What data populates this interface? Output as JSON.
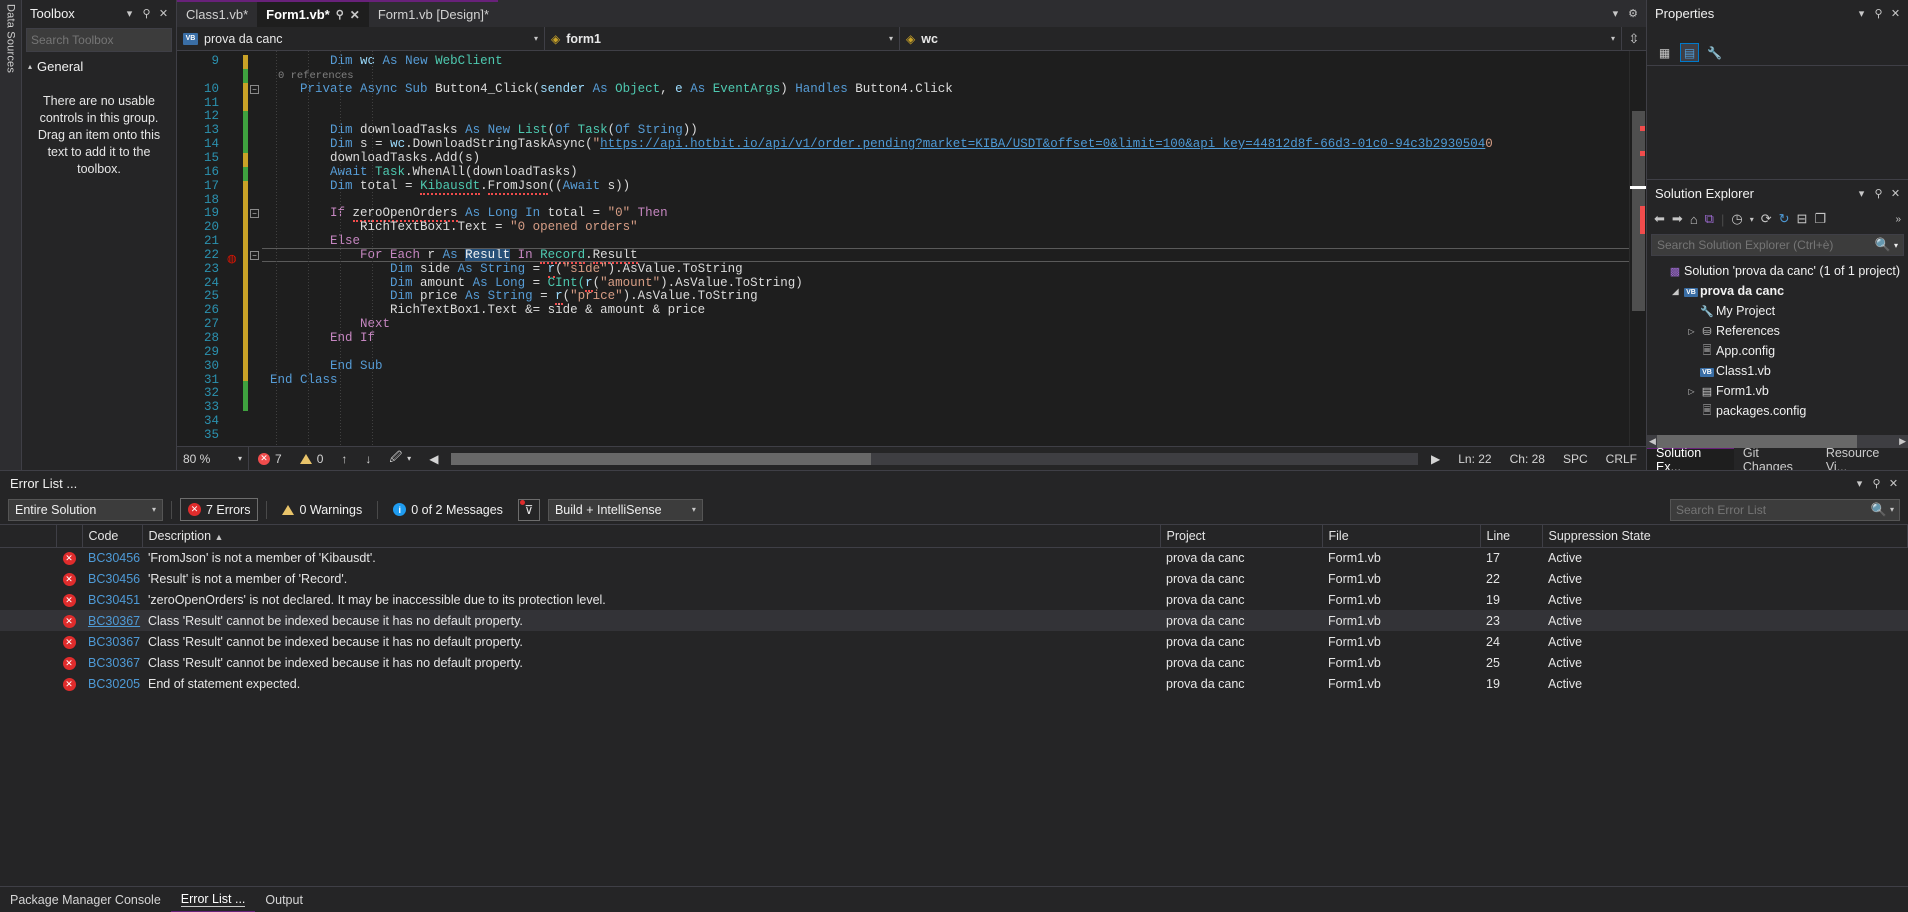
{
  "left_strip": {
    "label": "Data Sources"
  },
  "toolbox": {
    "title": "Toolbox",
    "search_placeholder": "Search Toolbox",
    "group_label": "General",
    "empty_message": "There are no usable controls in this group. Drag an item onto this text to add it to the toolbox.",
    "chevron": "▾",
    "pin": "⚲",
    "close": "✕",
    "magnifier": "🔍",
    "group_arrow": "▴"
  },
  "tabs": [
    {
      "label": "Class1.vb*",
      "active": false
    },
    {
      "label": "Form1.vb*",
      "active": true
    },
    {
      "label": "Form1.vb [Design]*",
      "active": false
    }
  ],
  "navbar": {
    "project": "prova da canc",
    "project_badge": "VB",
    "object": "form1",
    "member": "wc",
    "caret": "▾"
  },
  "editor": {
    "codelens": "0 references",
    "lines": [
      {
        "n": 9,
        "indent": 2,
        "tokens": [
          {
            "t": "Dim ",
            "c": "kw"
          },
          {
            "t": "wc",
            "c": "id"
          },
          {
            "t": " As ",
            "c": "kw"
          },
          {
            "t": "New ",
            "c": "kw"
          },
          {
            "t": "WebClient",
            "c": "ty"
          }
        ]
      },
      {
        "n": 10,
        "indent": 1,
        "fold": true,
        "tokens": [
          {
            "t": "Private ",
            "c": "kw"
          },
          {
            "t": "Async ",
            "c": "kw"
          },
          {
            "t": "Sub ",
            "c": "kw"
          },
          {
            "t": "Button4_Click",
            "c": "pl"
          },
          {
            "t": "(",
            "c": "pl"
          },
          {
            "t": "sender ",
            "c": "id"
          },
          {
            "t": "As ",
            "c": "kw"
          },
          {
            "t": "Object",
            "c": "ty"
          },
          {
            "t": ", ",
            "c": "pl"
          },
          {
            "t": "e ",
            "c": "id"
          },
          {
            "t": "As ",
            "c": "kw"
          },
          {
            "t": "EventArgs",
            "c": "ty"
          },
          {
            "t": ") ",
            "c": "pl"
          },
          {
            "t": "Handles ",
            "c": "kw"
          },
          {
            "t": "Button4.Click",
            "c": "pl"
          }
        ]
      },
      {
        "n": 11,
        "indent": 0,
        "tokens": []
      },
      {
        "n": 12,
        "indent": 0,
        "tokens": []
      },
      {
        "n": 13,
        "indent": 2,
        "tokens": [
          {
            "t": "Dim ",
            "c": "kw"
          },
          {
            "t": "downloadTasks",
            "c": "pl"
          },
          {
            "t": " As ",
            "c": "kw"
          },
          {
            "t": "New ",
            "c": "kw"
          },
          {
            "t": "List",
            "c": "ty"
          },
          {
            "t": "(",
            "c": "pl"
          },
          {
            "t": "Of ",
            "c": "kw"
          },
          {
            "t": "Task",
            "c": "ty"
          },
          {
            "t": "(",
            "c": "pl"
          },
          {
            "t": "Of ",
            "c": "kw"
          },
          {
            "t": "String",
            "c": "kw"
          },
          {
            "t": "))",
            "c": "pl"
          }
        ]
      },
      {
        "n": 14,
        "indent": 2,
        "tokens": [
          {
            "t": "Dim ",
            "c": "kw"
          },
          {
            "t": "s ",
            "c": "pl"
          },
          {
            "t": "= ",
            "c": "pl"
          },
          {
            "t": "wc",
            "c": "id"
          },
          {
            "t": ".DownloadStringTaskAsync",
            "c": "pl"
          },
          {
            "t": "(",
            "c": "pl"
          },
          {
            "t": "\"",
            "c": "st"
          },
          {
            "t": "https://api.hotbit.io/api/v1/order.pending?market=KIBA/USDT&offset=0&limit=100&api_key=44812d8f-66d3-01c0-94c3b2930504",
            "c": "link"
          },
          {
            "t": "0",
            "c": "st"
          }
        ]
      },
      {
        "n": 15,
        "indent": 2,
        "tokens": [
          {
            "t": "downloadTasks",
            "c": "pl"
          },
          {
            "t": ".Add(",
            "c": "pl"
          },
          {
            "t": "s",
            "c": "pl"
          },
          {
            "t": ")",
            "c": "pl"
          }
        ]
      },
      {
        "n": 16,
        "indent": 2,
        "tokens": [
          {
            "t": "Await ",
            "c": "kw"
          },
          {
            "t": "Task",
            "c": "ty"
          },
          {
            "t": ".WhenAll(",
            "c": "pl"
          },
          {
            "t": "downloadTasks",
            "c": "pl"
          },
          {
            "t": ")",
            "c": "pl"
          }
        ]
      },
      {
        "n": 17,
        "indent": 2,
        "tokens": [
          {
            "t": "Dim ",
            "c": "kw"
          },
          {
            "t": "total ",
            "c": "pl"
          },
          {
            "t": "= ",
            "c": "pl"
          },
          {
            "t": "Kibausdt",
            "c": "ty",
            "err": true
          },
          {
            "t": ".",
            "c": "pl"
          },
          {
            "t": "FromJson",
            "c": "pl",
            "err": true
          },
          {
            "t": "((",
            "c": "pl"
          },
          {
            "t": "Await ",
            "c": "kw"
          },
          {
            "t": "s",
            "c": "pl"
          },
          {
            "t": "))",
            "c": "pl"
          }
        ]
      },
      {
        "n": 18,
        "indent": 0,
        "tokens": []
      },
      {
        "n": 19,
        "indent": 2,
        "fold": true,
        "tokens": [
          {
            "t": "If ",
            "c": "kw2"
          },
          {
            "t": "zeroOpenOrders",
            "c": "pl",
            "err": true
          },
          {
            "t": " As ",
            "c": "kw"
          },
          {
            "t": "Long ",
            "c": "kw"
          },
          {
            "t": "In ",
            "c": "kw"
          },
          {
            "t": "total ",
            "c": "pl"
          },
          {
            "t": "= ",
            "c": "pl"
          },
          {
            "t": "\"0\" ",
            "c": "st"
          },
          {
            "t": "Then",
            "c": "kw2"
          }
        ]
      },
      {
        "n": 20,
        "indent": 3,
        "tokens": [
          {
            "t": "RichTextBox1",
            "c": "pl"
          },
          {
            "t": ".Text ",
            "c": "pl"
          },
          {
            "t": "= ",
            "c": "pl"
          },
          {
            "t": "\"0 opened orders\"",
            "c": "st"
          }
        ]
      },
      {
        "n": 21,
        "indent": 2,
        "tokens": [
          {
            "t": "Else",
            "c": "kw2"
          }
        ]
      },
      {
        "n": 22,
        "indent": 3,
        "fold": true,
        "current": true,
        "breakpoint": true,
        "tokens": [
          {
            "t": "For ",
            "c": "kw2"
          },
          {
            "t": "Each ",
            "c": "kw2"
          },
          {
            "t": "r ",
            "c": "pl"
          },
          {
            "t": "As ",
            "c": "kw"
          },
          {
            "t": "Result",
            "c": "sel"
          },
          {
            "t": " In ",
            "c": "kw2"
          },
          {
            "t": "Record",
            "c": "ty",
            "err": true
          },
          {
            "t": ".",
            "c": "pl"
          },
          {
            "t": "Result",
            "c": "pl",
            "err": true
          }
        ]
      },
      {
        "n": 23,
        "indent": 4,
        "tokens": [
          {
            "t": "Dim ",
            "c": "kw"
          },
          {
            "t": "side ",
            "c": "pl"
          },
          {
            "t": "As ",
            "c": "kw"
          },
          {
            "t": "String ",
            "c": "kw"
          },
          {
            "t": "= ",
            "c": "pl"
          },
          {
            "t": "r",
            "c": "id",
            "err": true
          },
          {
            "t": "(",
            "c": "pl"
          },
          {
            "t": "\"side\"",
            "c": "st"
          },
          {
            "t": ").AsValue.ToString",
            "c": "pl"
          }
        ]
      },
      {
        "n": 24,
        "indent": 4,
        "tokens": [
          {
            "t": "Dim ",
            "c": "kw"
          },
          {
            "t": "amount ",
            "c": "pl"
          },
          {
            "t": "As ",
            "c": "kw"
          },
          {
            "t": "Long ",
            "c": "kw"
          },
          {
            "t": "= ",
            "c": "pl"
          },
          {
            "t": "CInt(",
            "c": "ty"
          },
          {
            "t": "r",
            "c": "id",
            "err": true
          },
          {
            "t": "(",
            "c": "pl"
          },
          {
            "t": "\"amount\"",
            "c": "st"
          },
          {
            "t": ").AsValue.ToString)",
            "c": "pl"
          }
        ]
      },
      {
        "n": 25,
        "indent": 4,
        "tokens": [
          {
            "t": "Dim ",
            "c": "kw"
          },
          {
            "t": "price ",
            "c": "pl"
          },
          {
            "t": "As ",
            "c": "kw"
          },
          {
            "t": "String ",
            "c": "kw"
          },
          {
            "t": "= ",
            "c": "pl"
          },
          {
            "t": "r",
            "c": "id",
            "err": true
          },
          {
            "t": "(",
            "c": "pl"
          },
          {
            "t": "\"price\"",
            "c": "st"
          },
          {
            "t": ").AsValue.ToString",
            "c": "pl"
          }
        ]
      },
      {
        "n": 26,
        "indent": 4,
        "tokens": [
          {
            "t": "RichTextBox1",
            "c": "pl"
          },
          {
            "t": ".Text ",
            "c": "pl"
          },
          {
            "t": "&= ",
            "c": "pl"
          },
          {
            "t": "side ",
            "c": "pl"
          },
          {
            "t": "& ",
            "c": "pl"
          },
          {
            "t": "amount ",
            "c": "pl"
          },
          {
            "t": "& ",
            "c": "pl"
          },
          {
            "t": "price",
            "c": "pl"
          }
        ]
      },
      {
        "n": 27,
        "indent": 3,
        "tokens": [
          {
            "t": "Next",
            "c": "kw2"
          }
        ]
      },
      {
        "n": 28,
        "indent": 2,
        "tokens": [
          {
            "t": "End ",
            "c": "kw2"
          },
          {
            "t": "If",
            "c": "kw2"
          }
        ]
      },
      {
        "n": 29,
        "indent": 0,
        "tokens": []
      },
      {
        "n": 30,
        "indent": 2,
        "tokens": [
          {
            "t": "End ",
            "c": "kw"
          },
          {
            "t": "Sub",
            "c": "kw"
          }
        ]
      },
      {
        "n": 31,
        "indent": 0,
        "tokens": [
          {
            "t": "End ",
            "c": "kw"
          },
          {
            "t": "Class",
            "c": "kw"
          }
        ]
      },
      {
        "n": 32,
        "indent": 0,
        "tokens": []
      },
      {
        "n": 33,
        "indent": 0,
        "tokens": []
      },
      {
        "n": 34,
        "indent": 0,
        "tokens": []
      },
      {
        "n": 35,
        "indent": 0,
        "tokens": []
      }
    ]
  },
  "editor_status": {
    "zoom": "80 %",
    "errors": "7",
    "warnings": "0",
    "up_arrow": "↑",
    "down_arrow": "↓",
    "line": "Ln: 22",
    "col": "Ch: 28",
    "spaces": "SPC",
    "eol": "CRLF"
  },
  "properties": {
    "title": "Properties",
    "chevron": "▾",
    "pin": "⚲",
    "close": "✕",
    "buttons": [
      "categorized-icon",
      "alphabetical-icon",
      "properties-icon"
    ]
  },
  "solution_explorer": {
    "title": "Solution Explorer",
    "search_placeholder": "Search Solution Explorer (Ctrl+è)",
    "toolbar_icons": [
      "back-icon",
      "forward-icon",
      "home-icon",
      "sync-icon",
      "pending-changes-icon",
      "refresh-icon",
      "collapse-all-icon",
      "show-all-files-icon",
      "properties-icon"
    ],
    "tree": [
      {
        "label": "Solution 'prova da canc' (1 of 1 project)",
        "depth": 0,
        "expander": "",
        "icon": "solution-icon",
        "bold": false
      },
      {
        "label": "prova da canc",
        "depth": 1,
        "expander": "◢",
        "icon": "VB",
        "bold": true
      },
      {
        "label": "My Project",
        "depth": 2,
        "expander": "",
        "icon": "wrench-icon",
        "bold": false
      },
      {
        "label": "References",
        "depth": 2,
        "expander": "▷",
        "icon": "references-icon",
        "bold": false
      },
      {
        "label": "App.config",
        "depth": 2,
        "expander": "",
        "icon": "config-icon",
        "bold": false
      },
      {
        "label": "Class1.vb",
        "depth": 2,
        "expander": "",
        "icon": "VB",
        "bold": false
      },
      {
        "label": "Form1.vb",
        "depth": 2,
        "expander": "▷",
        "icon": "form-icon",
        "bold": false
      },
      {
        "label": "packages.config",
        "depth": 2,
        "expander": "",
        "icon": "config-icon",
        "bold": false
      }
    ],
    "tabs": [
      {
        "label": "Solution Ex...",
        "active": true
      },
      {
        "label": "Git Changes",
        "active": false
      },
      {
        "label": "Resource Vi...",
        "active": false
      }
    ]
  },
  "error_list": {
    "title": "Error List ...",
    "scope": "Entire Solution",
    "errors_label": "7 Errors",
    "warnings_label": "0 Warnings",
    "messages_label": "0 of 2 Messages",
    "build_filter": "Build + IntelliSense",
    "search_placeholder": "Search Error List",
    "columns": [
      "",
      "",
      "Code",
      "Description",
      "Project",
      "File",
      "Line",
      "Suppression State"
    ],
    "sort_indicator": "▲",
    "rows": [
      {
        "code": "BC30456",
        "description": "'FromJson' is not a member of 'Kibausdt'.",
        "project": "prova da canc",
        "file": "Form1.vb",
        "line": "17",
        "suppression": "Active",
        "selected": false
      },
      {
        "code": "BC30456",
        "description": "'Result' is not a member of 'Record'.",
        "project": "prova da canc",
        "file": "Form1.vb",
        "line": "22",
        "suppression": "Active",
        "selected": false
      },
      {
        "code": "BC30451",
        "description": "'zeroOpenOrders' is not declared. It may be inaccessible due to its protection level.",
        "project": "prova da canc",
        "file": "Form1.vb",
        "line": "19",
        "suppression": "Active",
        "selected": false
      },
      {
        "code": "BC30367",
        "description": "Class 'Result' cannot be indexed because it has no default property.",
        "project": "prova da canc",
        "file": "Form1.vb",
        "line": "23",
        "suppression": "Active",
        "selected": true
      },
      {
        "code": "BC30367",
        "description": "Class 'Result' cannot be indexed because it has no default property.",
        "project": "prova da canc",
        "file": "Form1.vb",
        "line": "24",
        "suppression": "Active",
        "selected": false
      },
      {
        "code": "BC30367",
        "description": "Class 'Result' cannot be indexed because it has no default property.",
        "project": "prova da canc",
        "file": "Form1.vb",
        "line": "25",
        "suppression": "Active",
        "selected": false
      },
      {
        "code": "BC30205",
        "description": "End of statement expected.",
        "project": "prova da canc",
        "file": "Form1.vb",
        "line": "19",
        "suppression": "Active",
        "selected": false
      }
    ]
  },
  "bottom_tabs": [
    {
      "label": "Package Manager Console",
      "active": false
    },
    {
      "label": "Error List ...",
      "active": true
    },
    {
      "label": "Output",
      "active": false
    }
  ]
}
